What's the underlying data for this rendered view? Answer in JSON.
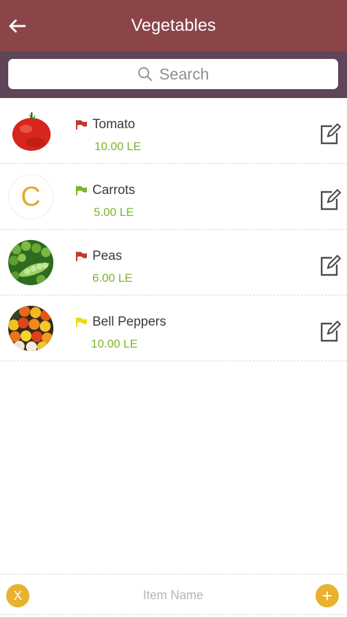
{
  "header": {
    "title": "Vegetables",
    "back_icon": "arrow-left-icon",
    "background": "#8b4549"
  },
  "search": {
    "placeholder": "Search",
    "icon": "search-icon",
    "band_color": "#5e4558"
  },
  "items": [
    {
      "name": "Tomato",
      "price": "10.00 LE",
      "flag_color": "#c0392b",
      "thumb": "tomato-photo"
    },
    {
      "name": "Carrots",
      "price": "5.00 LE",
      "flag_color": "#7ab52a",
      "thumb_letter": "C"
    },
    {
      "name": "Peas",
      "price": "6.00 LE",
      "flag_color": "#c0392b",
      "thumb": "peas-photo"
    },
    {
      "name": "Bell Peppers",
      "price": "10.00 LE",
      "flag_color": "#f0d90d",
      "thumb": "bell-peppers-photo"
    }
  ],
  "bottom": {
    "clear_label": "X",
    "input_placeholder": "Item Name",
    "add_label": "+",
    "accent": "#e8b22e"
  }
}
